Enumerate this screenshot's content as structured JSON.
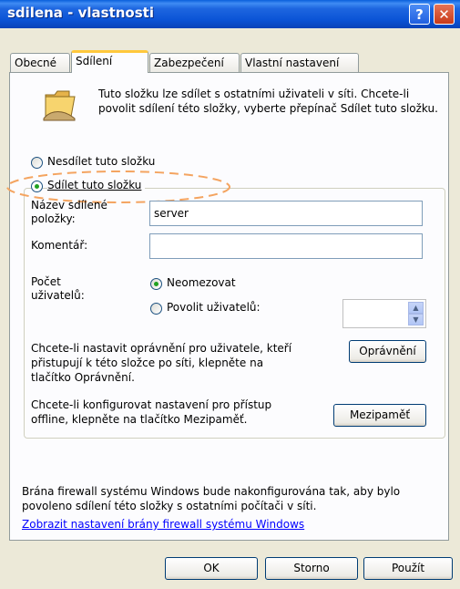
{
  "window": {
    "title": "sdilena - vlastnosti",
    "help_label": "?",
    "close_label": "✕"
  },
  "tabs": [
    {
      "label": "Obecné"
    },
    {
      "label": "Sdílení"
    },
    {
      "label": "Zabezpečení"
    },
    {
      "label": "Vlastní nastavení"
    }
  ],
  "intro": {
    "text": "Tuto složku lze sdílet s ostatními uživateli v síti. Chcete-li povolit sdílení této složky, vyberte přepínač Sdílet tuto složku."
  },
  "radios": {
    "noshare": "Nesdílet tuto složku",
    "share": "Sdílet tuto složku",
    "selected": "share"
  },
  "fields": {
    "share_name_label": "Název sdílené položky:",
    "share_name_value": "server",
    "comment_label": "Komentář:",
    "comment_value": ""
  },
  "users": {
    "label": "Počet uživatelů:",
    "unlimited": "Neomezovat",
    "allow": "Povolit uživatelů:",
    "selected": "unlimited",
    "count_value": ""
  },
  "permissions": {
    "text": "Chcete-li nastavit oprávnění pro uživatele, kteří přistupují k této složce po síti, klepněte na tlačítko Oprávnění.",
    "button": "Oprávnění"
  },
  "caching": {
    "text": "Chcete-li konfigurovat nastavení pro přístup offline, klepněte na tlačítko Mezipaměť.",
    "button": "Mezipaměť"
  },
  "firewall": {
    "text": "Brána firewall systému Windows bude nakonfigurována tak, aby bylo povoleno sdílení této složky s ostatními počítači v síti.",
    "link": "Zobrazit nastavení brány firewall systému Windows"
  },
  "footer": {
    "ok": "OK",
    "cancel": "Storno",
    "apply": "Použít"
  },
  "colors": {
    "titlebar": "#0A54D6",
    "highlight_ellipse": "#F4A460",
    "active_tab_accent": "#FFC83C"
  }
}
